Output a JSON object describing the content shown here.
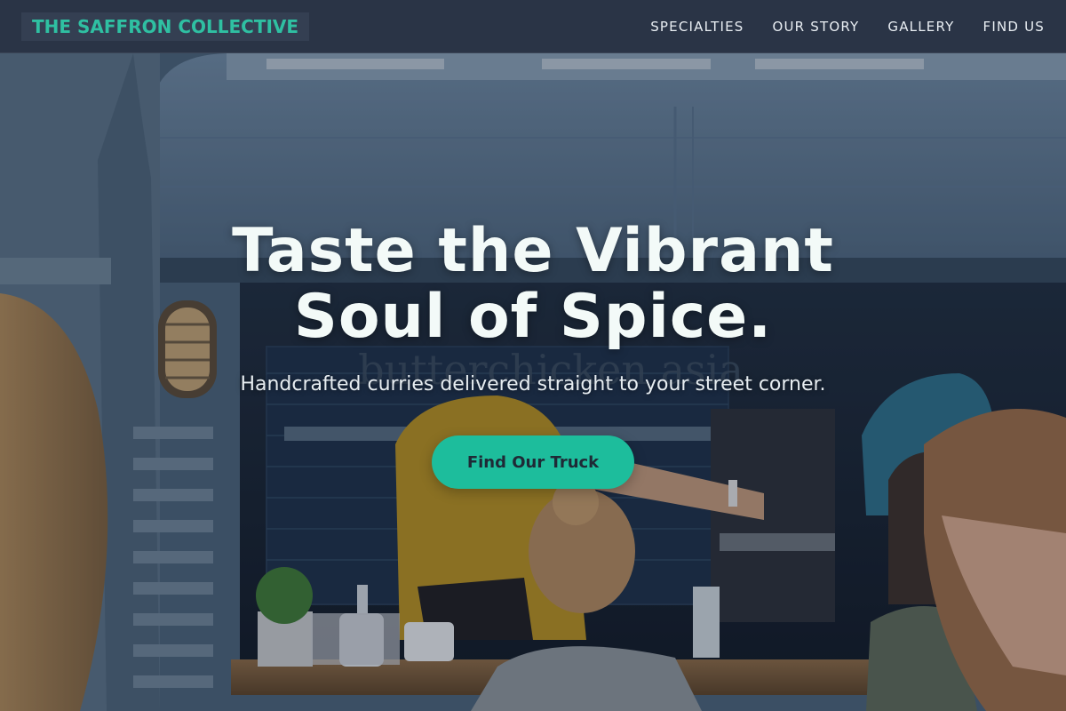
{
  "header": {
    "brand": "THE SAFFRON COLLECTIVE",
    "nav": [
      {
        "label": "SPECIALTIES"
      },
      {
        "label": "OUR STORY"
      },
      {
        "label": "GALLERY"
      },
      {
        "label": "FIND US"
      }
    ]
  },
  "hero": {
    "title_line1": "Taste the Vibrant",
    "title_line2": "Soul of Spice.",
    "subtitle": "Handcrafted curries delivered straight to your street corner.",
    "cta_label": "Find Our Truck",
    "truck_sign": "butterchicken asia"
  },
  "colors": {
    "accent": "#1dbd9c",
    "brand_text": "#2fc0a2",
    "nav_bg": "#2a3446"
  }
}
